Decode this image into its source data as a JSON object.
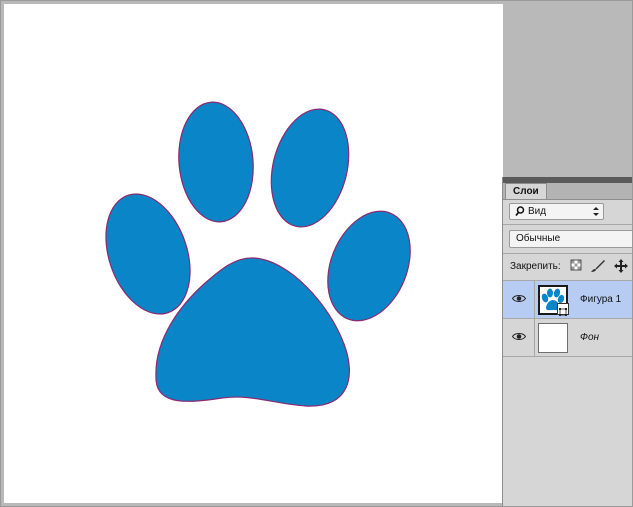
{
  "document": {
    "shape": "paw-print",
    "fill_color": "#0a85c8",
    "stroke_color": "#8b2a6e",
    "background_color": "#ffffff"
  },
  "layers_panel": {
    "tab_label": "Слои",
    "filter": {
      "search_icon": "search-icon",
      "value": "Вид"
    },
    "blend_mode": "Обычные",
    "lock_label": "Закрепить:",
    "lock_icons": [
      "lock-transparent-pixels-icon",
      "lock-image-pixels-icon",
      "lock-position-icon"
    ],
    "layers": [
      {
        "name": "Фигура 1",
        "visible": true,
        "selected": true,
        "type": "shape",
        "selection_color": "#b6ccf2"
      },
      {
        "name": "Фон",
        "visible": true,
        "selected": false,
        "type": "background"
      }
    ]
  }
}
